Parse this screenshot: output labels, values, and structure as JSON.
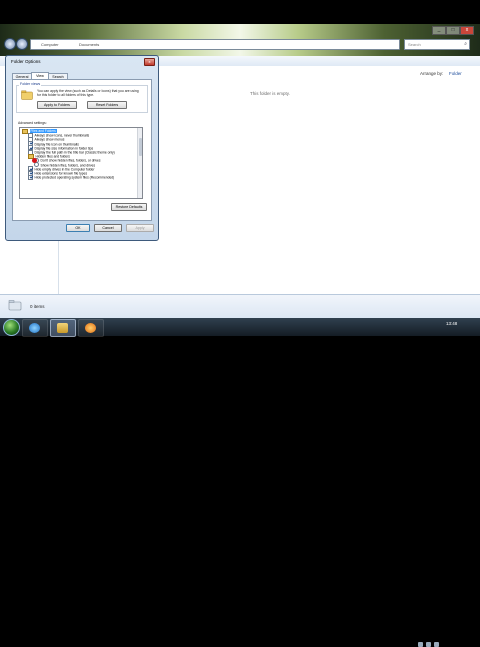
{
  "explorer": {
    "address_crumbs": [
      "Computer",
      "Documents"
    ],
    "search_placeholder": "Search",
    "arrange_by_label": "Arrange by:",
    "arrange_by_value": "Folder",
    "empty_message": "This folder is empty.",
    "items_count": "0 items"
  },
  "dialog": {
    "title": "Folder Options",
    "close_label": "x",
    "tabs": [
      {
        "label": "General",
        "active": false
      },
      {
        "label": "View",
        "active": true
      },
      {
        "label": "Search",
        "active": false
      }
    ],
    "folder_views": {
      "label": "Folder views",
      "description": "You can apply the view (such as Details or Icons) that you are using for this folder to all folders of this type.",
      "apply_button": "Apply to Folders",
      "reset_button": "Reset Folders"
    },
    "advanced_label": "Advanced settings:",
    "tree": [
      {
        "kind": "folder",
        "text": "Files and Folders",
        "selected": true
      },
      {
        "kind": "check",
        "text": "Always show icons, never thumbnails",
        "checked": false
      },
      {
        "kind": "check",
        "text": "Always show menus",
        "checked": false
      },
      {
        "kind": "check",
        "text": "Display file icon on thumbnails",
        "checked": true
      },
      {
        "kind": "check",
        "text": "Display file size information in folder tips",
        "checked": true
      },
      {
        "kind": "check",
        "text": "Display the full path in the title bar (Classic theme only)",
        "checked": false
      },
      {
        "kind": "folder",
        "text": "Hidden files and folders",
        "selected": false
      },
      {
        "kind": "radio",
        "text": "Don't show hidden files, folders, or drives",
        "checked": true
      },
      {
        "kind": "radio",
        "text": "Show hidden files, folders, and drives",
        "checked": false
      },
      {
        "kind": "check",
        "text": "Hide empty drives in the Computer folder",
        "checked": true
      },
      {
        "kind": "check",
        "text": "Hide extensions for known file types",
        "checked": true
      },
      {
        "kind": "check",
        "text": "Hide protected operating system files (Recommended)",
        "checked": true
      }
    ],
    "restore_defaults_button": "Restore Defaults",
    "ok_button": "OK",
    "cancel_button": "Cancel",
    "apply_button": "Apply"
  },
  "taskbar": {
    "time": "13:48",
    "date": "",
    "colors": {
      "accent": "#3399ff"
    }
  }
}
